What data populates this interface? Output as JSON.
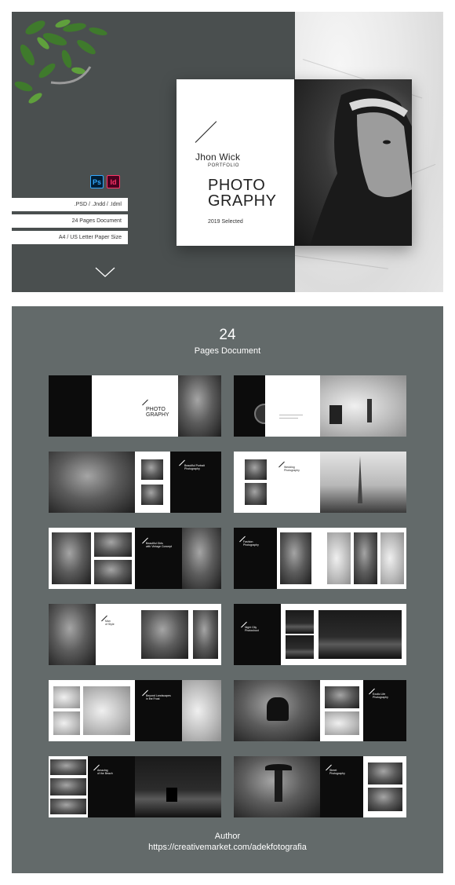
{
  "hero": {
    "formats": {
      "ps_label": "Ps",
      "id_label": "Id"
    },
    "specs": [
      ".PSD / .Jndd / .Idml",
      "24 Pages Document",
      "A4 / US Letter Paper Size"
    ],
    "cover": {
      "name": "Jhon Wick",
      "subtitle": "PORTFOLIO",
      "title_line1": "PHOTO",
      "title_line2": "GRAPHY",
      "year_label": "2019 Selected"
    }
  },
  "preview": {
    "page_count": "24",
    "pages_label": "Pages Document"
  },
  "footer": {
    "author_label": "Author",
    "author_url": "https://creativemarket.com/adekfotografia"
  },
  "colors": {
    "hero_dark": "#4a4f4f",
    "preview_bg": "#636a6a",
    "photoshop_brand": "#31a8ff",
    "indesign_brand": "#ff3366"
  },
  "icons": [
    "plant-decoration",
    "photoshop-icon",
    "indesign-icon",
    "chevron-down-icon"
  ]
}
